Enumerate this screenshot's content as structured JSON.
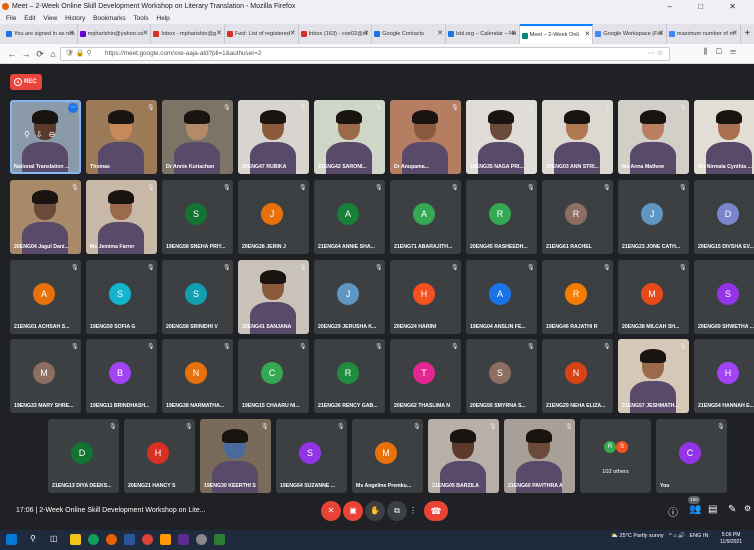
{
  "window": {
    "title": "Meet – 2-Week Online Skill Development Workshop on Literary Translation - Mozilla Firefox",
    "controls": [
      "–",
      "□",
      "✕"
    ]
  },
  "menu": [
    "File",
    "Edit",
    "View",
    "History",
    "Bookmarks",
    "Tools",
    "Help"
  ],
  "tabs": [
    {
      "label": "You are signed in as ncc",
      "color": "#1a73e8"
    },
    {
      "label": "mpharishin@yahoo.co",
      "color": "#6001d2"
    },
    {
      "label": "Inbox - mpharishin@g",
      "color": "#d93025"
    },
    {
      "label": "Fwd: List of registered",
      "color": "#d93025"
    },
    {
      "label": "Inbox (163) - coe02@st",
      "color": "#d93025"
    },
    {
      "label": "Google Contacts",
      "color": "#1a73e8"
    },
    {
      "label": "lsbl.org – Calendar – No",
      "color": "#1a73e8"
    },
    {
      "label": "Meet – 2-Week Onli",
      "color": "#00897b",
      "active": true
    },
    {
      "label": "Google Workspace (For",
      "color": "#4285f4"
    },
    {
      "label": "maximum number of m",
      "color": "#4285f4"
    }
  ],
  "url": "https://meet.google.com/xxe-aaja-atd?pli=1&authuser=2",
  "rec_label": "REC",
  "tiles": [
    {
      "name": "National Translation ...",
      "video": true,
      "bg": "#8a9aa8",
      "skin": "#5a3a2a",
      "self": true
    },
    {
      "name": "Thomas",
      "video": true,
      "bg": "#9c7a58",
      "skin": "#c98a5a"
    },
    {
      "name": "Dr Annie Kuriachan",
      "video": true,
      "bg": "#7c7467",
      "skin": "#b58a6a"
    },
    {
      "name": "20ENG47 RUBIKA",
      "video": true,
      "bg": "#d8d4cf",
      "skin": "#8a5a3a"
    },
    {
      "name": "21ENG42 SARONI...",
      "video": true,
      "bg": "#cfd6c8",
      "skin": "#9a6a4a"
    },
    {
      "name": "Dr Anupama...",
      "video": true,
      "bg": "#b57d62",
      "skin": "#8a5a40"
    },
    {
      "name": "19ENG35 NAGA PRI...",
      "video": true,
      "bg": "#e0ddd8",
      "skin": "#6a4a3a"
    },
    {
      "name": "20ENG03 ANN STRI...",
      "video": true,
      "bg": "#dcd8d2",
      "skin": "#b07850"
    },
    {
      "name": "Ms Anna Mathew",
      "video": true,
      "bg": "#d2cec8",
      "skin": "#b88060"
    },
    {
      "name": "Ms Nirmala Cynthia ...",
      "video": true,
      "bg": "#e2ded6",
      "skin": "#a87050"
    },
    {
      "name": "20ENG04 Jagul Dani...",
      "video": true,
      "bg": "#a88a6a",
      "skin": "#6a4a3a"
    },
    {
      "name": "Ms Jemima Farrer",
      "video": true,
      "bg": "#c8b8a8",
      "skin": "#9a6a4a"
    },
    {
      "name": "19ENG58 SNEHA PRIY...",
      "letter": "S",
      "color": "#137333"
    },
    {
      "name": "20ENG28 JERIN J",
      "letter": "J",
      "color": "#e8710a"
    },
    {
      "name": "21ENG64 ANNIE SHA...",
      "letter": "A",
      "color": "#188038"
    },
    {
      "name": "21ENG71 ABARAJITH...",
      "letter": "A",
      "color": "#34a853"
    },
    {
      "name": "20ENG45 RASHEEDH...",
      "letter": "R",
      "color": "#34a853"
    },
    {
      "name": "21ENG61 RACHEL",
      "letter": "R",
      "color": "#8d6e63"
    },
    {
      "name": "21ENG23 JONE CATH...",
      "letter": "J",
      "color": "#5e97c4"
    },
    {
      "name": "20ENG15 DIVSHA EV...",
      "letter": "D",
      "color": "#7986cb"
    },
    {
      "name": "21ENG01 ACHSAH S...",
      "letter": "A",
      "color": "#e8710a"
    },
    {
      "name": "19ENG59 SOFIA G",
      "letter": "S",
      "color": "#12b5cb"
    },
    {
      "name": "20ENG58 SRINIDHI V",
      "letter": "S",
      "color": "#129eaf"
    },
    {
      "name": "20ENG41 SANJANA",
      "video": true,
      "bg": "#c9c2b8",
      "skin": "#8a5a3a"
    },
    {
      "name": "20ENG29 JERUSHA K...",
      "letter": "J",
      "color": "#5e97c4"
    },
    {
      "name": "20ENG24 HARINI",
      "letter": "H",
      "color": "#f4511e"
    },
    {
      "name": "19ENG04 ANSLIN FE...",
      "letter": "A",
      "color": "#1a73e8"
    },
    {
      "name": "19ENG46 RAJATHI R",
      "letter": "R",
      "color": "#f57c00"
    },
    {
      "name": "20ENG38 MILCAH SH...",
      "letter": "M",
      "color": "#e64a19"
    },
    {
      "name": "20ENG69 SHWETHA ...",
      "letter": "S",
      "color": "#9334e6"
    },
    {
      "name": "19ENG33 MARY SHRE...",
      "letter": "M",
      "color": "#8d6e63"
    },
    {
      "name": "19ENG11 BRINDHASH...",
      "letter": "B",
      "color": "#a142f4"
    },
    {
      "name": "19ENG38 NARMATHA...",
      "letter": "N",
      "color": "#e8710a"
    },
    {
      "name": "19ENG15 CHAARU NI...",
      "letter": "C",
      "color": "#34a853"
    },
    {
      "name": "21ENG36 RENCY GAB...",
      "letter": "R",
      "color": "#1e8e3e"
    },
    {
      "name": "20ENG62 THASLIMA N",
      "letter": "T",
      "color": "#e52592"
    },
    {
      "name": "20ENG56 SMYRNA S...",
      "letter": "S",
      "color": "#8d6e63"
    },
    {
      "name": "21ENG29 NEHA ELIZA...",
      "letter": "N",
      "color": "#d84315"
    },
    {
      "name": "21ENG57 JESHMATH...",
      "video": true,
      "bg": "#d6c8b8",
      "skin": "#9a6a4a"
    },
    {
      "name": "21ENG54 HANNAH E...",
      "letter": "H",
      "color": "#a142f4"
    },
    {
      "name": "21ENG13 DIYA DEEKS...",
      "letter": "D",
      "color": "#137333"
    },
    {
      "name": "20ENG21 HANCY S",
      "letter": "H",
      "color": "#d93025"
    },
    {
      "name": "19ENG30 KEERTHI S",
      "video": true,
      "bg": "#7a6a5a",
      "skin": "#4a6a9a"
    },
    {
      "name": "19ENG64 SUZANNE ...",
      "letter": "S",
      "color": "#9334e6"
    },
    {
      "name": "Ms Angeline Premku...",
      "letter": "M",
      "color": "#e8710a"
    },
    {
      "name": "21ENG05 BARZILA",
      "video": true,
      "bg": "#b8b0a8",
      "skin": "#5a3a2a"
    },
    {
      "name": "21ENG60 PAVITHRA A",
      "video": true,
      "bg": "#a8a098",
      "skin": "#6a4a3a"
    },
    {
      "name": "102 others",
      "others": true
    },
    {
      "name": "You",
      "letter": "C",
      "color": "#9334e6"
    }
  ],
  "others_letters": [
    {
      "letter": "R",
      "color": "#34a853"
    },
    {
      "letter": "S",
      "color": "#f4511e"
    }
  ],
  "meeting": {
    "time": "17:06",
    "title": "2-Week Online Skill Development Workshop on Lite...",
    "people_count": "150"
  },
  "taskbar": {
    "weather": "25°C Partly sunny",
    "lang": "ENG IN",
    "time": "5:06 PM",
    "date": "11/9/2021"
  }
}
